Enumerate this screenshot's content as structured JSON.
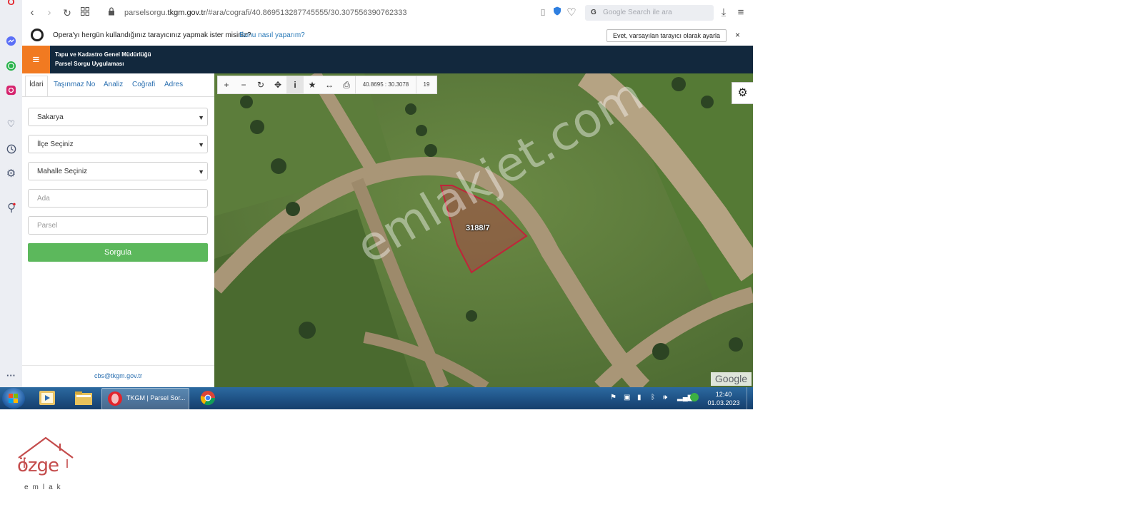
{
  "sidebar": {
    "icons": [
      "opera-icon",
      "messenger-icon",
      "whatsapp-icon",
      "instagram-icon",
      "heart-icon",
      "clock-icon",
      "gear-icon",
      "pin-icon",
      "more-icon"
    ]
  },
  "browser": {
    "url_prefix": "parselsorgu.",
    "url_domain": "tkgm.gov.tr",
    "url_path": "/#ara/cografi/40.869513287745555/30.307556390762333",
    "search_placeholder": "Google Search ile ara"
  },
  "banner": {
    "message": "Opera'yı hergün kullandığınız tarayıcınız yapmak ister misiniz?",
    "link": "Bunu nasıl yaparım?",
    "button": "Evet, varsayılan tarayıcı olarak ayarla",
    "close": "×"
  },
  "app": {
    "title_line1": "Tapu ve Kadastro Genel Müdürlüğü",
    "title_line2": "Parsel Sorgu Uygulaması",
    "menu_icon": "≡"
  },
  "tabs": [
    "İdari",
    "Taşınmaz No",
    "Analiz",
    "Coğrafi",
    "Adres"
  ],
  "form": {
    "il": "Sakarya",
    "ilce": "İlçe Seçiniz",
    "mahalle": "Mahalle Seçiniz",
    "ada_placeholder": "Ada",
    "parsel_placeholder": "Parsel",
    "submit": "Sorgula"
  },
  "footer_email": "cbs@tkgm.gov.tr",
  "map": {
    "coords": "40.8695 : 30.3078",
    "zoom": "19",
    "parcel_label": "3188/7",
    "attribution": "Google",
    "watermark": "emlakjet.com"
  },
  "taskbar": {
    "active_window": "TKGM | Parsel Sor...",
    "time": "12:40",
    "date": "01.03.2023"
  },
  "logo": {
    "name": "özge",
    "sub": "emlak"
  },
  "colors": {
    "header": "#12283d",
    "menu_btn": "#f17a21",
    "submit": "#5cb85c",
    "parcel": "#c0243a"
  }
}
